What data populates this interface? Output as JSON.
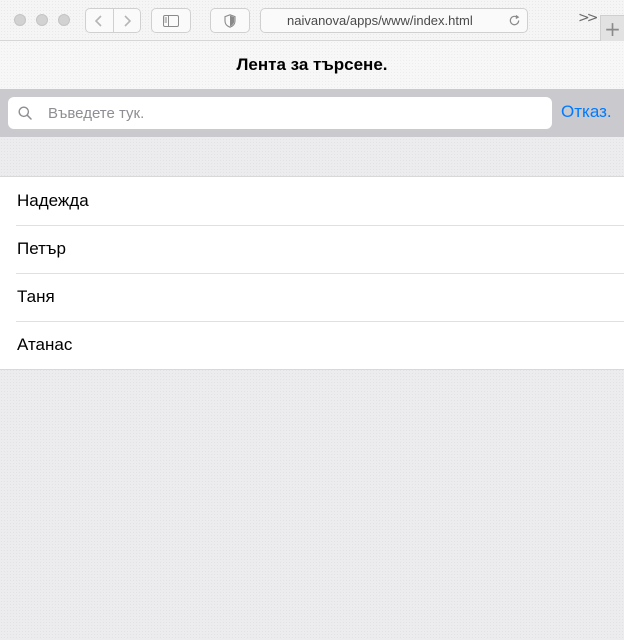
{
  "browser": {
    "url": "naivanova/apps/www/index.html",
    "overflow_label": ">>",
    "new_tab_label": "+"
  },
  "app": {
    "title": "Лента за търсене."
  },
  "search": {
    "placeholder": "Въведете тук.",
    "value": "",
    "cancel_label": "Отказ."
  },
  "list": {
    "items": [
      "Надежда",
      "Петър",
      "Таня",
      "Атанас"
    ]
  },
  "colors": {
    "accent": "#007aff",
    "searchbar_bg": "#c9c9ce"
  }
}
